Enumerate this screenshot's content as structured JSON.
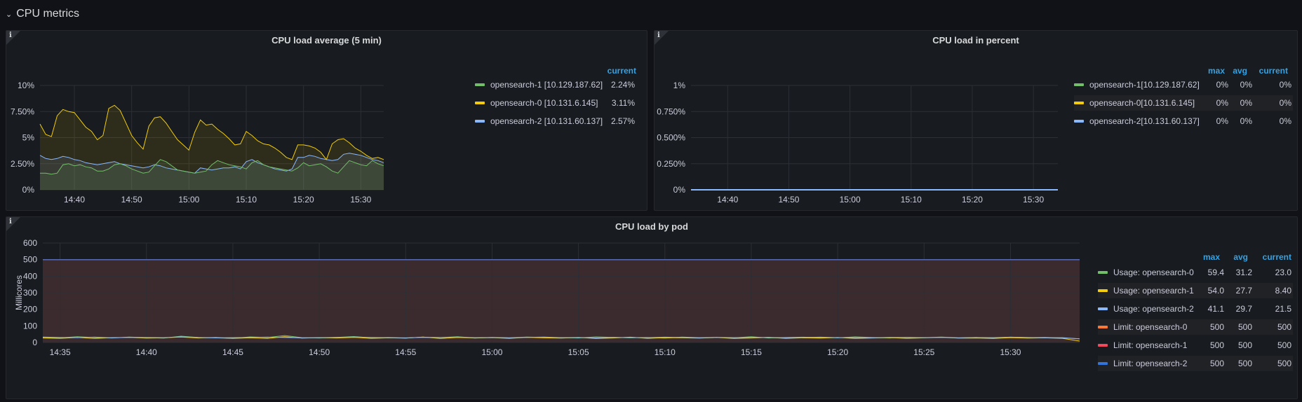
{
  "row": {
    "title": "CPU metrics",
    "chevron": "chevron-down-icon"
  },
  "panels": {
    "load_avg": {
      "title": "CPU load average (5 min)",
      "info_icon": "info-icon",
      "legend_header": "current",
      "legend": [
        {
          "name": "opensearch-1 [10.129.187.62]",
          "current": "2.24%",
          "color": "#73bf69"
        },
        {
          "name": "opensearch-0 [10.131.6.145]",
          "current": "3.11%",
          "color": "#f2cc0c"
        },
        {
          "name": "opensearch-2 [10.131.60.137]",
          "current": "2.57%",
          "color": "#8ab8ff"
        }
      ]
    },
    "load_pct": {
      "title": "CPU load in percent",
      "info_icon": "info-icon",
      "legend_headers": {
        "max": "max",
        "avg": "avg",
        "current": "current"
      },
      "legend": [
        {
          "name": "opensearch-1[10.129.187.62]",
          "max": "0%",
          "avg": "0%",
          "current": "0%",
          "color": "#73bf69"
        },
        {
          "name": "opensearch-0[10.131.6.145]",
          "max": "0%",
          "avg": "0%",
          "current": "0%",
          "color": "#f2cc0c"
        },
        {
          "name": "opensearch-2[10.131.60.137]",
          "max": "0%",
          "avg": "0%",
          "current": "0%",
          "color": "#8ab8ff"
        }
      ]
    },
    "by_pod": {
      "title": "CPU load by pod",
      "info_icon": "info-icon",
      "legend_headers": {
        "max": "max",
        "avg": "avg",
        "current": "current"
      },
      "legend": [
        {
          "name": "Usage: opensearch-0",
          "max": "59.4",
          "avg": "31.2",
          "current": "23.0",
          "color": "#73bf69"
        },
        {
          "name": "Usage: opensearch-1",
          "max": "54.0",
          "avg": "27.7",
          "current": "8.40",
          "color": "#f2cc0c"
        },
        {
          "name": "Usage: opensearch-2",
          "max": "41.1",
          "avg": "29.7",
          "current": "21.5",
          "color": "#8ab8ff"
        },
        {
          "name": "Limit: opensearch-0",
          "max": "500",
          "avg": "500",
          "current": "500",
          "color": "#ff7833"
        },
        {
          "name": "Limit: opensearch-1",
          "max": "500",
          "avg": "500",
          "current": "500",
          "color": "#f2495c"
        },
        {
          "name": "Limit: opensearch-2",
          "max": "500",
          "avg": "500",
          "current": "500",
          "color": "#3274d9"
        }
      ]
    }
  },
  "chart_data": [
    {
      "type": "area",
      "title": "CPU load average (5 min)",
      "ylabel": "",
      "ylim": [
        0,
        10
      ],
      "y_ticks": [
        "0%",
        "2.50%",
        "5%",
        "7.50%",
        "10%"
      ],
      "x_ticks": [
        "14:40",
        "14:50",
        "15:00",
        "15:10",
        "15:20",
        "15:30"
      ],
      "x_start": "14:34",
      "x_end": "15:34",
      "x": [
        "14:34",
        "14:35",
        "14:36",
        "14:37",
        "14:38",
        "14:39",
        "14:40",
        "14:41",
        "14:42",
        "14:43",
        "14:44",
        "14:45",
        "14:46",
        "14:47",
        "14:48",
        "14:49",
        "14:50",
        "14:51",
        "14:52",
        "14:53",
        "14:54",
        "14:55",
        "14:56",
        "14:57",
        "14:58",
        "14:59",
        "15:00",
        "15:01",
        "15:02",
        "15:03",
        "15:04",
        "15:05",
        "15:06",
        "15:07",
        "15:08",
        "15:09",
        "15:10",
        "15:11",
        "15:12",
        "15:13",
        "15:14",
        "15:15",
        "15:16",
        "15:17",
        "15:18",
        "15:19",
        "15:20",
        "15:21",
        "15:22",
        "15:23",
        "15:24",
        "15:25",
        "15:26",
        "15:27",
        "15:28",
        "15:29",
        "15:30",
        "15:31",
        "15:32",
        "15:33",
        "15:34"
      ],
      "series": [
        {
          "name": "opensearch-0 [10.131.6.145]",
          "color": "#f2cc0c",
          "values": [
            6.3,
            5.3,
            5.1,
            7.1,
            7.7,
            7.5,
            7.4,
            6.7,
            6.0,
            5.6,
            4.8,
            5.2,
            7.8,
            8.1,
            7.6,
            6.4,
            5.2,
            4.5,
            3.9,
            6.1,
            6.9,
            7.0,
            6.4,
            5.6,
            4.8,
            4.3,
            3.8,
            5.5,
            6.7,
            6.2,
            6.3,
            5.8,
            5.4,
            4.9,
            4.3,
            4.4,
            5.6,
            5.2,
            4.7,
            4.4,
            4.3,
            4.0,
            3.6,
            3.1,
            2.9,
            4.3,
            4.3,
            4.2,
            4.0,
            3.6,
            2.9,
            4.4,
            4.8,
            4.9,
            4.5,
            4.0,
            3.7,
            3.3,
            3.0,
            3.1,
            2.9
          ]
        },
        {
          "name": "opensearch-2 [10.131.60.137]",
          "color": "#8ab8ff",
          "values": [
            3.3,
            3.0,
            2.9,
            3.0,
            3.2,
            3.1,
            2.9,
            2.8,
            2.6,
            2.5,
            2.4,
            2.5,
            2.6,
            2.7,
            2.5,
            2.4,
            2.3,
            2.2,
            2.1,
            2.2,
            2.4,
            2.3,
            2.1,
            2.0,
            1.9,
            1.8,
            1.7,
            1.6,
            2.1,
            2.0,
            1.9,
            2.0,
            2.1,
            2.1,
            2.2,
            2.0,
            2.7,
            2.9,
            2.6,
            2.4,
            2.2,
            2.0,
            1.9,
            1.8,
            2.0,
            3.1,
            3.1,
            3.3,
            3.2,
            3.0,
            2.9,
            2.8,
            2.9,
            3.4,
            3.5,
            3.4,
            3.3,
            3.1,
            2.9,
            2.8,
            2.6
          ]
        },
        {
          "name": "opensearch-1 [10.129.187.62]",
          "color": "#73bf69",
          "values": [
            1.6,
            1.6,
            1.5,
            1.6,
            2.4,
            2.5,
            2.3,
            2.4,
            2.2,
            2.1,
            1.8,
            1.8,
            2.0,
            2.4,
            2.5,
            2.3,
            2.0,
            1.8,
            1.6,
            1.7,
            2.3,
            2.9,
            2.7,
            2.3,
            1.9,
            1.8,
            1.7,
            1.6,
            1.7,
            1.8,
            2.4,
            2.8,
            2.6,
            2.4,
            2.3,
            2.2,
            2.0,
            2.6,
            2.8,
            2.4,
            2.2,
            2.1,
            2.0,
            1.9,
            1.8,
            2.1,
            2.6,
            2.3,
            2.4,
            2.5,
            2.2,
            1.8,
            1.6,
            2.2,
            2.8,
            2.6,
            2.4,
            2.3,
            2.8,
            2.5,
            2.3
          ]
        }
      ]
    },
    {
      "type": "line",
      "title": "CPU load in percent",
      "ylabel": "",
      "ylim": [
        0,
        1
      ],
      "y_ticks": [
        "0%",
        "0.250%",
        "0.500%",
        "0.750%",
        "1%"
      ],
      "x_ticks": [
        "14:40",
        "14:50",
        "15:00",
        "15:10",
        "15:20",
        "15:30"
      ],
      "x_start": "14:34",
      "x_end": "15:34",
      "series": [
        {
          "name": "opensearch-1[10.129.187.62]",
          "color": "#73bf69",
          "values": [
            0,
            0
          ]
        },
        {
          "name": "opensearch-0[10.131.6.145]",
          "color": "#f2cc0c",
          "values": [
            0,
            0
          ]
        },
        {
          "name": "opensearch-2[10.131.60.137]",
          "color": "#8ab8ff",
          "values": [
            0,
            0
          ]
        }
      ]
    },
    {
      "type": "line",
      "title": "CPU load by pod",
      "ylabel": "Millicores",
      "ylim": [
        0,
        600
      ],
      "y_ticks": [
        "0",
        "100",
        "200",
        "300",
        "400",
        "500",
        "600"
      ],
      "x_ticks": [
        "14:35",
        "14:40",
        "14:45",
        "14:50",
        "14:55",
        "15:00",
        "15:05",
        "15:10",
        "15:15",
        "15:20",
        "15:25",
        "15:30"
      ],
      "x_start": "14:34",
      "x_end": "15:34",
      "series": [
        {
          "name": "Usage: opensearch-0",
          "color": "#73bf69",
          "values": [
            31,
            28,
            35,
            30,
            27,
            33,
            29,
            26,
            38,
            30,
            28,
            25,
            34,
            30,
            42,
            29,
            27,
            31,
            36,
            28,
            30,
            26,
            32,
            29,
            35,
            27,
            31,
            28,
            33,
            30,
            29,
            27,
            34,
            31,
            28,
            30,
            26,
            33,
            29,
            31,
            28,
            35,
            27,
            30,
            32,
            29,
            28,
            34,
            30,
            27,
            31,
            29,
            33,
            28,
            30,
            26,
            32,
            29,
            31,
            27,
            23
          ]
        },
        {
          "name": "Usage: opensearch-1",
          "color": "#f2cc0c",
          "values": [
            27,
            25,
            30,
            24,
            29,
            31,
            26,
            28,
            33,
            27,
            30,
            25,
            28,
            24,
            35,
            26,
            29,
            27,
            31,
            25,
            28,
            26,
            33,
            24,
            30,
            27,
            29,
            25,
            31,
            28,
            26,
            30,
            24,
            27,
            32,
            25,
            29,
            28,
            26,
            30,
            24,
            27,
            31,
            25,
            28,
            26,
            30,
            24,
            27,
            29,
            25,
            28,
            31,
            26,
            27,
            24,
            29,
            26,
            28,
            25,
            8.4
          ]
        },
        {
          "name": "Usage: opensearch-2",
          "color": "#8ab8ff",
          "values": [
            33,
            30,
            29,
            32,
            28,
            31,
            30,
            29,
            34,
            30,
            28,
            29,
            31,
            32,
            30,
            28,
            29,
            31,
            33,
            30,
            29,
            28,
            31,
            30,
            32,
            29,
            30,
            28,
            31,
            33,
            29,
            30,
            28,
            31,
            30,
            29,
            32,
            30,
            28,
            31,
            29,
            30,
            31,
            28,
            30,
            32,
            29,
            30,
            28,
            31,
            30,
            29,
            31,
            28,
            30,
            29,
            32,
            30,
            28,
            29,
            21.5
          ]
        },
        {
          "name": "Limit: opensearch-0",
          "color": "#ff7833",
          "values": [
            500,
            500
          ]
        },
        {
          "name": "Limit: opensearch-1",
          "color": "#f2495c",
          "values": [
            500,
            500
          ]
        },
        {
          "name": "Limit: opensearch-2",
          "color": "#3274d9",
          "values": [
            500,
            500
          ]
        }
      ]
    }
  ]
}
